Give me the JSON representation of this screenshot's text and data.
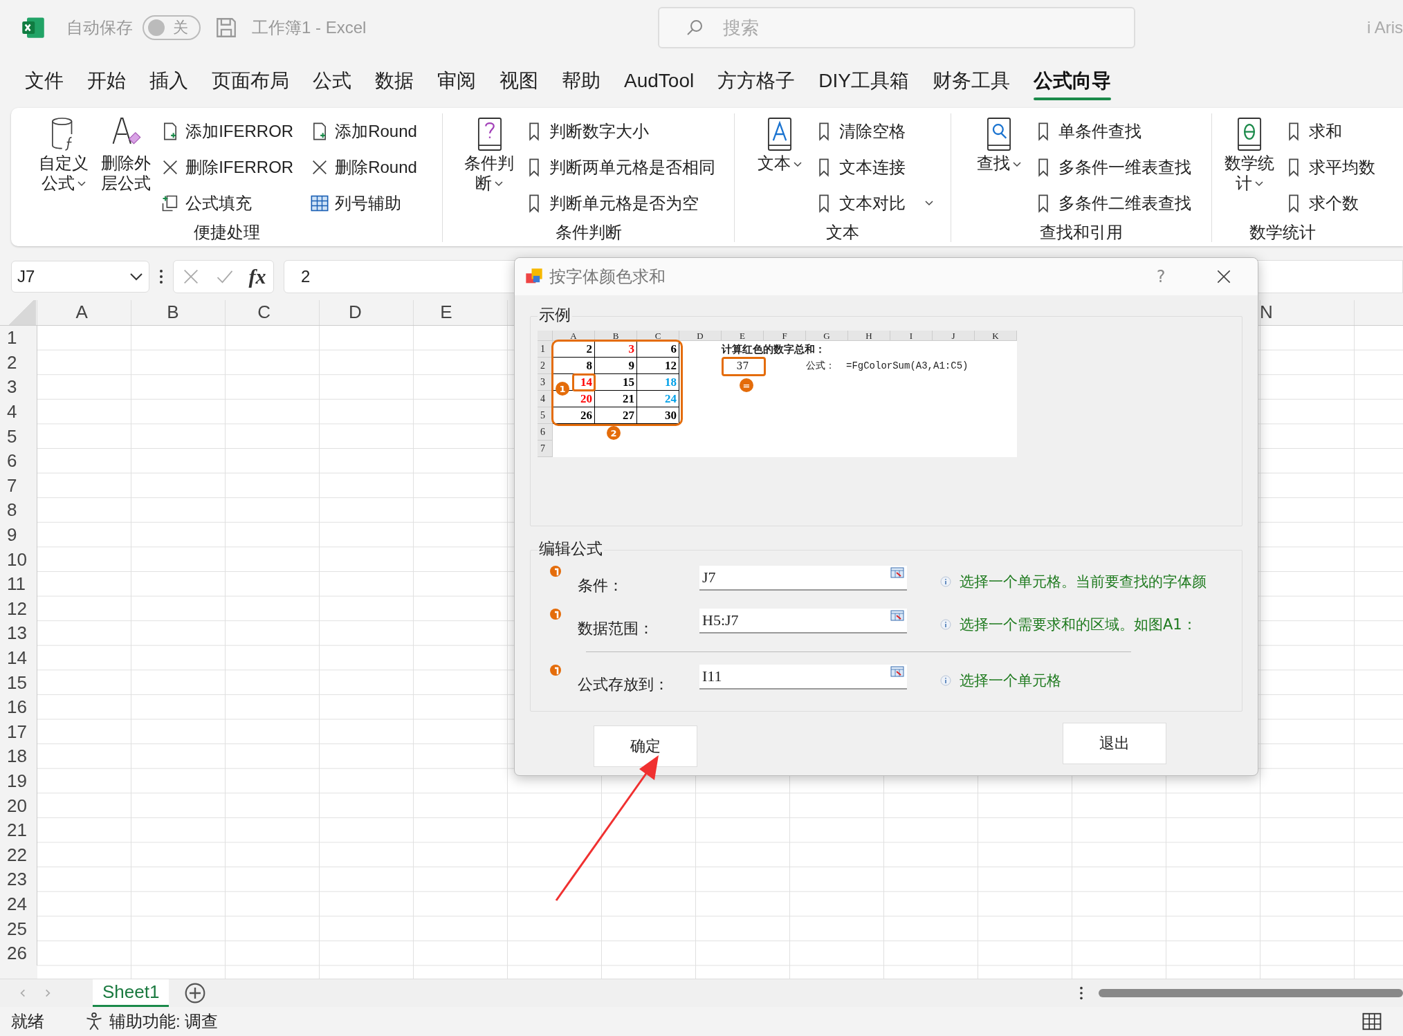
{
  "titlebar": {
    "autosave_label": "自动保存",
    "autosave": {
      "on": false,
      "label": "关"
    },
    "document": "工作簿1  -  Excel",
    "search": {
      "placeholder": "搜索"
    },
    "user": "i Aris"
  },
  "tabs": [
    {
      "label": "文件",
      "selected": false
    },
    {
      "label": "开始",
      "selected": false
    },
    {
      "label": "插入",
      "selected": false
    },
    {
      "label": "页面布局",
      "selected": false
    },
    {
      "label": "公式",
      "selected": false
    },
    {
      "label": "数据",
      "selected": false
    },
    {
      "label": "审阅",
      "selected": false
    },
    {
      "label": "视图",
      "selected": false
    },
    {
      "label": "帮助",
      "selected": false
    },
    {
      "label": "AudTool",
      "selected": false
    },
    {
      "label": "方方格子",
      "selected": false
    },
    {
      "label": "DIY工具箱",
      "selected": false
    },
    {
      "label": "财务工具",
      "selected": false
    },
    {
      "label": "公式向导",
      "selected": true
    }
  ],
  "ribbon": [
    {
      "label": "便捷处理",
      "big": [
        {
          "label": "自定义公式",
          "menu": true
        },
        {
          "label": "删除外层公式",
          "menu": false
        }
      ],
      "items": [
        {
          "label": "添加IFERROR"
        },
        {
          "label": "删除IFERROR"
        },
        {
          "label": "公式填充"
        },
        {
          "label": "添加Round"
        },
        {
          "label": "删除Round"
        },
        {
          "label": "列号辅助"
        }
      ]
    },
    {
      "label": "条件判断",
      "big": [
        {
          "label": "条件判断",
          "menu": true
        }
      ],
      "items": [
        {
          "label": "判断数字大小"
        },
        {
          "label": "判断两单元格是否相同"
        },
        {
          "label": "判断单元格是否为空"
        }
      ]
    },
    {
      "label": "文本",
      "big": [
        {
          "label": "文本",
          "menu": true
        }
      ],
      "items": [
        {
          "label": "清除空格"
        },
        {
          "label": "文本连接"
        },
        {
          "label": "文本对比",
          "menu": true
        }
      ]
    },
    {
      "label": "查找和引用",
      "big": [
        {
          "label": "查找",
          "menu": true
        }
      ],
      "items": [
        {
          "label": "单条件查找"
        },
        {
          "label": "多条件一维表查找"
        },
        {
          "label": "多条件二维表查找"
        }
      ]
    },
    {
      "label": "数学统计",
      "big": [
        {
          "label": "数学统计",
          "menu": true
        }
      ],
      "items": [
        {
          "label": "求和"
        },
        {
          "label": "求平均数"
        },
        {
          "label": "求个数"
        }
      ]
    }
  ],
  "formula_bar": {
    "name_box": "J7",
    "fx": "fx",
    "value": "2"
  },
  "sheet": {
    "columns": [
      "A",
      "B",
      "C",
      "D",
      "E",
      "N"
    ],
    "rows": [
      "1",
      "2",
      "3",
      "4",
      "5",
      "6",
      "7",
      "8",
      "9",
      "10",
      "11",
      "12",
      "13",
      "14",
      "15",
      "16",
      "17",
      "18",
      "19",
      "20",
      "21",
      "22",
      "23",
      "24",
      "25",
      "26"
    ]
  },
  "dialog": {
    "title": "按字体颜色求和",
    "help": "?",
    "example": {
      "group": "示例",
      "columns": [
        "A",
        "B",
        "C",
        "D",
        "E",
        "F",
        "G",
        "H",
        "I",
        "J",
        "K"
      ],
      "rows": [
        {
          "label": "1",
          "values": [
            {
              "text": "2",
              "color": "#000000"
            },
            {
              "text": "3",
              "color": "#ff0000"
            },
            {
              "text": "6",
              "color": "#000000"
            }
          ]
        },
        {
          "label": "2",
          "values": [
            {
              "text": "8",
              "color": "#000000"
            },
            {
              "text": "9",
              "color": "#000000"
            },
            {
              "text": "12",
              "color": "#000000"
            }
          ]
        },
        {
          "label": "3",
          "values": [
            {
              "text": "14",
              "color": "#ff0000"
            },
            {
              "text": "15",
              "color": "#000000"
            },
            {
              "text": "18",
              "color": "#00a0e8"
            }
          ]
        },
        {
          "label": "4",
          "values": [
            {
              "text": "20",
              "color": "#ff0000"
            },
            {
              "text": "21",
              "color": "#000000"
            },
            {
              "text": "24",
              "color": "#00a0e8"
            }
          ]
        },
        {
          "label": "5",
          "values": [
            {
              "text": "26",
              "color": "#000000"
            },
            {
              "text": "27",
              "color": "#000000"
            },
            {
              "text": "30",
              "color": "#000000"
            }
          ]
        },
        {
          "label": "6"
        },
        {
          "label": "7"
        }
      ],
      "title": "计算红色的数字总和：",
      "result": "37",
      "formula_label": "公式：",
      "formula": "=FgColorSum(A3,A1:C5)",
      "callouts": [
        "1",
        "2",
        "="
      ]
    },
    "edit": {
      "group": "编辑公式",
      "fields": [
        {
          "label": "条件：",
          "value": "J7",
          "hint": "选择一个单元格。当前要查找的字体颜"
        },
        {
          "label": "数据范围：",
          "value": "H5:J7",
          "hint": "选择一个需要求和的区域。如图A1："
        },
        {
          "label": "公式存放到：",
          "value": "I11",
          "hint": "选择一个单元格"
        }
      ]
    },
    "buttons": [
      "确定",
      "退出"
    ]
  },
  "sheet_tabs": [
    {
      "label": "Sheet1",
      "selected": true
    }
  ],
  "status_bar": {
    "ready": "就绪",
    "accessibility": "辅助功能: 调查"
  }
}
